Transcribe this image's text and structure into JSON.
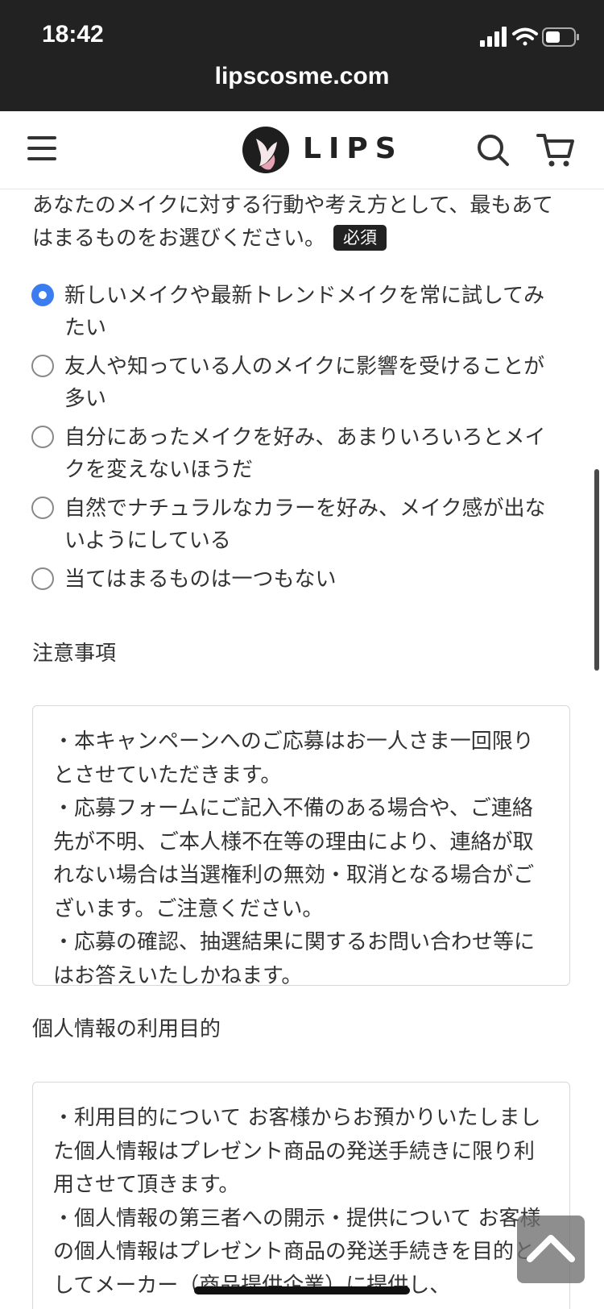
{
  "status_bar": {
    "time": "18:42",
    "url": "lipscosme.com",
    "icons": [
      "signal-icon",
      "wifi-icon",
      "battery-icon"
    ]
  },
  "navbar": {
    "menu_icon": "hamburger-menu-icon",
    "logo_text": "LIPS",
    "search_icon": "search-icon",
    "cart_icon": "cart-icon"
  },
  "question": {
    "text": "あなたのメイクに対する行動や考え方として、最もあてはまるものをお選びください。",
    "required_label": "必須",
    "options": [
      {
        "label": "新しいメイクや最新トレンドメイクを常に試してみたい",
        "checked": true
      },
      {
        "label": "友人や知っている人のメイクに影響を受けることが多い",
        "checked": false
      },
      {
        "label": "自分にあったメイクを好み、あまりいろいろとメイクを変えないほうだ",
        "checked": false
      },
      {
        "label": "自然でナチュラルなカラーを好み、メイク感が出ないようにしている",
        "checked": false
      },
      {
        "label": "当てはまるものは一つもない",
        "checked": false
      }
    ]
  },
  "notice": {
    "title": "注意事項",
    "body": "・本キャンペーンへのご応募はお一人さま一回限りとさせていただきます。\n・応募フォームにご記入不備のある場合や、ご連絡先が不明、ご本人様不在等の理由により、連絡が取れない場合は当選権利の無効・取消となる場合がございます。ご注意ください。\n・応募の確認、抽選結果に関するお問い合わせ等にはお答えいたしかねます。"
  },
  "privacy": {
    "title": "個人情報の利用目的",
    "body": "・利用目的について お客様からお預かりいたしました個人情報はプレゼント商品の発送手続きに限り利用させて頂きます。\n・個人情報の第三者への開示・提供について お客様の個人情報はプレゼント商品の発送手続きを目的としてメーカー（商品提供企業）に提供し、"
  },
  "colors": {
    "status_bar_bg": "#222222",
    "radio_checked": "#3b7cf0",
    "badge_bg": "#222222"
  }
}
